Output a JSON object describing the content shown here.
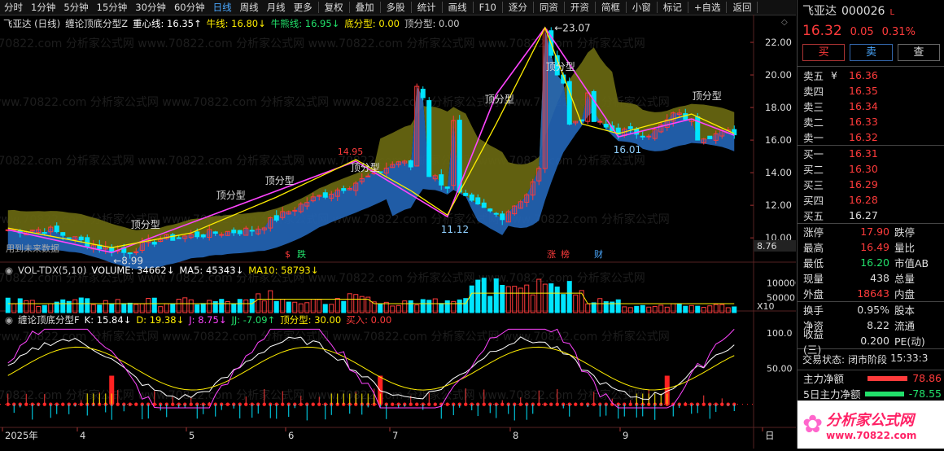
{
  "toolbar": {
    "periods": [
      "分时",
      "1分钟",
      "5分钟",
      "15分钟",
      "30分钟",
      "60分钟",
      "日线",
      "周线",
      "月线",
      "更多"
    ],
    "tools": [
      "复权",
      "叠加",
      "多股",
      "统计",
      "画线",
      "F10",
      "逐分",
      "同资",
      "开资",
      "简框",
      "小窗",
      "标记",
      "+自选",
      "返回"
    ]
  },
  "main_chart": {
    "title": "飞亚达 (日线)",
    "indicator": "缠论顶底分型Z",
    "fields": [
      {
        "label": "重心线:",
        "value": "16.35",
        "arrow": "↑",
        "color": "#ffffff"
      },
      {
        "label": "牛线:",
        "value": "16.80",
        "arrow": "↓",
        "color": "#ffee00"
      },
      {
        "label": "牛熊线:",
        "value": "16.95",
        "arrow": "↓",
        "color": "#22e06a"
      },
      {
        "label": "底分型:",
        "value": "0.00",
        "arrow": "",
        "color": "#ffee00"
      },
      {
        "label": "顶分型:",
        "value": "0.00",
        "arrow": "",
        "color": "#cccccc"
      }
    ],
    "price_axis": [
      "22.00",
      "20.00",
      "18.00",
      "16.00",
      "14.00",
      "12.00",
      "10.00"
    ],
    "price_range": [
      8.76,
      23.5
    ],
    "current_price_tag": "8.76",
    "note": "用到未来数据",
    "annotations": {
      "high": "23.07",
      "low1": "8.99",
      "low2": "11.12",
      "low3": "16.01",
      "mark_1495": "14.95"
    },
    "fractal_label": "顶分型",
    "event_marks": [
      {
        "text": "$",
        "color": "#ff3b3b"
      },
      {
        "text": "跌",
        "color": "#22e06a"
      },
      {
        "text": "涨",
        "color": "#ff3b3b"
      },
      {
        "text": "榜",
        "color": "#ff3b3b"
      },
      {
        "text": "财",
        "color": "#4aa8ff"
      }
    ]
  },
  "volume_chart": {
    "indicator": "VOL-TDX(5,10)",
    "fields": [
      {
        "label": "VOLUME:",
        "value": "34662",
        "arrow": "↓",
        "color": "#ffffff"
      },
      {
        "label": "MA5:",
        "value": "45343",
        "arrow": "↓",
        "color": "#ffffff"
      },
      {
        "label": "MA10:",
        "value": "58793",
        "arrow": "↓",
        "color": "#ffee00"
      }
    ],
    "axis": [
      "100000",
      "50000"
    ],
    "unit": "X10"
  },
  "kdj_chart": {
    "indicator": "缠论顶底分型F",
    "fields": [
      {
        "label": "K:",
        "value": "15.84",
        "arrow": "↓",
        "color": "#ffffff"
      },
      {
        "label": "D:",
        "value": "19.38",
        "arrow": "↓",
        "color": "#ffee00"
      },
      {
        "label": "J:",
        "value": "8.75",
        "arrow": "↓",
        "color": "#ff44ff"
      },
      {
        "label": "JJ:",
        "value": "-7.09",
        "arrow": "↑",
        "color": "#22e06a"
      },
      {
        "label": "顶分型:",
        "value": "30.00",
        "arrow": "",
        "color": "#ffee00"
      },
      {
        "label": "买入:",
        "value": "0.00",
        "arrow": "",
        "color": "#ff3b3b"
      }
    ],
    "axis": [
      "100.0",
      "50.00"
    ]
  },
  "date_axis": [
    "2025年",
    "4",
    "5",
    "6",
    "7",
    "8",
    "9",
    "日"
  ],
  "quote": {
    "name": "飞亚达",
    "code": "000026",
    "market": "L",
    "price": "16.32",
    "change": "0.05",
    "change_pct": "0.31%",
    "buttons": {
      "buy": "买",
      "sell": "卖",
      "query": "查"
    },
    "asks": [
      {
        "label": "卖五",
        "flag": "¥",
        "price": "16.36"
      },
      {
        "label": "卖四",
        "flag": "",
        "price": "16.35"
      },
      {
        "label": "卖三",
        "flag": "",
        "price": "16.34"
      },
      {
        "label": "卖二",
        "flag": "",
        "price": "16.33"
      },
      {
        "label": "卖一",
        "flag": "",
        "price": "16.32"
      }
    ],
    "bids": [
      {
        "label": "买一",
        "price": "16.31",
        "color": "#ff3b3b"
      },
      {
        "label": "买二",
        "price": "16.30",
        "color": "#ff3b3b"
      },
      {
        "label": "买三",
        "price": "16.29",
        "color": "#ff3b3b"
      },
      {
        "label": "买四",
        "price": "16.28",
        "color": "#ff3b3b"
      },
      {
        "label": "买五",
        "price": "16.27",
        "color": "#dddddd"
      }
    ],
    "stats": [
      {
        "l1": "涨停",
        "v1": "17.90",
        "c1": "#ff3b3b",
        "l2": "跌停"
      },
      {
        "l1": "最高",
        "v1": "16.49",
        "c1": "#ff3b3b",
        "l2": "量比"
      },
      {
        "l1": "最低",
        "v1": "16.20",
        "c1": "#22e06a",
        "l2": "市值AB"
      },
      {
        "l1": "现量",
        "v1": "438",
        "c1": "#dddddd",
        "l2": "总量"
      },
      {
        "l1": "外盘",
        "v1": "18643",
        "c1": "#ff3b3b",
        "l2": "内盘"
      }
    ],
    "stats2": [
      {
        "l1": "换手",
        "v1": "0.95%",
        "l2": "股本"
      },
      {
        "l1": "净资",
        "v1": "8.22",
        "l2": "流通"
      },
      {
        "l1": "收益(三)",
        "v1": "0.200",
        "l2": "PE(动)"
      }
    ],
    "status_label": "交易状态:",
    "status_value": "闭市阶段",
    "status_time": "15:33:3",
    "flow1_label": "主力净额",
    "flow1_value": "78.86",
    "flow2_label": "5日主力净额",
    "flow2_value": "-78.55",
    "logo_text": "分析家公式网",
    "logo_url": "www.70822.com",
    "watermark": "www.70822.com 分析家公式网"
  },
  "colors": {
    "up": "#ff3b3b",
    "down": "#00e5ff",
    "cloud_upper": "#6b6a12",
    "cloud_lower": "#2466b8",
    "pen": "#ff44ff",
    "trend": "#ffee00"
  }
}
